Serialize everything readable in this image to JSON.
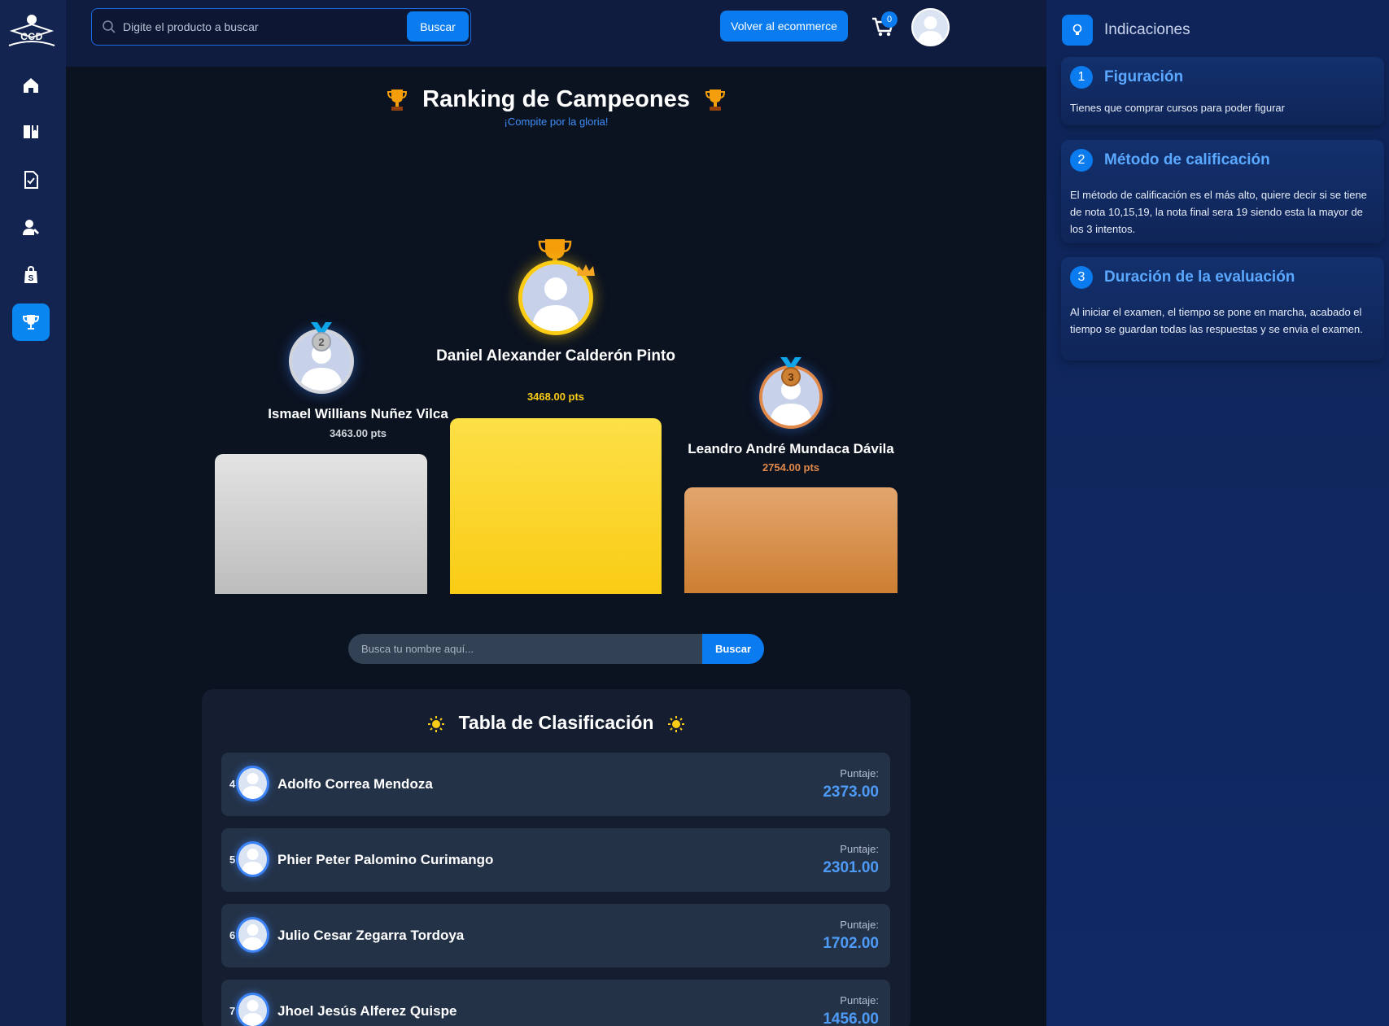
{
  "sidebar": {
    "logo_text": "CCD",
    "items": [
      {
        "name": "home-icon"
      },
      {
        "name": "book-icon"
      },
      {
        "name": "checklist-icon"
      },
      {
        "name": "user-icon"
      },
      {
        "name": "shop-icon"
      },
      {
        "name": "trophy-icon",
        "active": true
      }
    ]
  },
  "header": {
    "search_placeholder": "Digite el producto a buscar",
    "search_button": "Buscar",
    "back_button": "Volver al ecommerce",
    "cart_count": "0"
  },
  "main": {
    "title": "Ranking de Campeones",
    "subtitle": "¡Compite por la gloria!",
    "podium": {
      "first": {
        "name": "Daniel Alexander Calderón Pinto",
        "points": "3468.00 pts"
      },
      "second": {
        "name": "Ismael Willians Nuñez Vilca",
        "points": "3463.00 pts",
        "medal": "2"
      },
      "third": {
        "name": "Leandro André Mundaca Dávila",
        "points": "2754.00 pts",
        "medal": "3"
      }
    },
    "name_search": {
      "placeholder": "Busca tu nombre aquí...",
      "button": "Buscar"
    },
    "leaderboard": {
      "title": "Tabla de Clasificación",
      "score_label": "Puntaje:",
      "rows": [
        {
          "rank": "4",
          "name": "Adolfo Correa Mendoza",
          "score": "2373.00"
        },
        {
          "rank": "5",
          "name": "Phier Peter Palomino Curimango",
          "score": "2301.00"
        },
        {
          "rank": "6",
          "name": "Julio Cesar Zegarra Tordoya",
          "score": "1702.00"
        },
        {
          "rank": "7",
          "name": "Jhoel Jesús Alferez Quispe",
          "score": "1456.00"
        }
      ]
    }
  },
  "panel": {
    "title": "Indicaciones",
    "cards": [
      {
        "num": "1",
        "title": "Figuración",
        "text": "Tienes que comprar cursos para poder figurar"
      },
      {
        "num": "2",
        "title": "Método de calificación",
        "text": "El método de calificación es el más alto, quiere decir si se tiene de nota 10,15,19, la nota final sera 19 siendo esta la mayor de los 3 intentos."
      },
      {
        "num": "3",
        "title": "Duración de la evaluación",
        "text": "Al iniciar el examen, el tiempo se pone en marcha, acabado el tiempo se guardan todas las respuestas y se envia el examen."
      }
    ]
  },
  "colors": {
    "accent": "#0a7cf0",
    "gold": "#facc15",
    "silver": "#c9c9c9",
    "bronze": "#cd7f32"
  }
}
